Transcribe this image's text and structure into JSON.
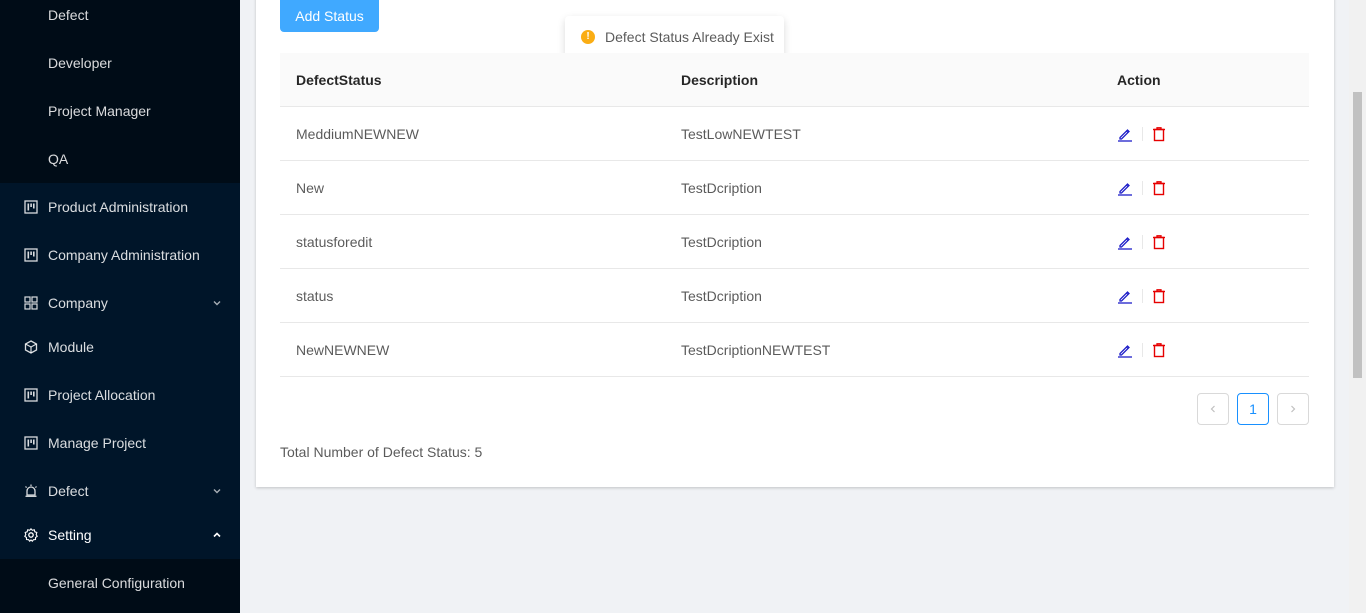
{
  "sidebar": {
    "sub_items": [
      "Defect",
      "Developer",
      "Project Manager",
      "QA"
    ],
    "items": [
      {
        "label": "Product Administration",
        "icon": "project-icon"
      },
      {
        "label": "Company Administration",
        "icon": "project-icon"
      },
      {
        "label": "Company",
        "icon": "appstore-icon",
        "arrow": "down"
      },
      {
        "label": "Module",
        "icon": "code-sandbox-icon"
      },
      {
        "label": "Project Allocation",
        "icon": "project-icon"
      },
      {
        "label": "Manage Project",
        "icon": "project-icon"
      },
      {
        "label": "Defect",
        "icon": "alert-icon",
        "arrow": "down"
      },
      {
        "label": "Setting",
        "icon": "setting-icon",
        "arrow": "up"
      }
    ],
    "setting_sub_items": [
      "General Configuration"
    ]
  },
  "toolbar": {
    "add_label": "Add Status"
  },
  "toast": {
    "message": "Defect Status Already Exist",
    "color": "#faad14"
  },
  "table": {
    "columns": [
      "DefectStatus",
      "Description",
      "Action"
    ],
    "rows": [
      {
        "status": "MeddiumNEWNEW",
        "description": "TestLowNEWTEST"
      },
      {
        "status": "New",
        "description": "TestDcription"
      },
      {
        "status": "statusforedit",
        "description": "TestDcription"
      },
      {
        "status": "status",
        "description": "TestDcription"
      },
      {
        "status": "NewNEWNEW",
        "description": "TestDcriptionNEWTEST"
      }
    ]
  },
  "pagination": {
    "prev": "<",
    "current": "1",
    "next": ">"
  },
  "footer": {
    "total_text": "Total Number of Defect Status: 5"
  },
  "colors": {
    "sidebar_bg": "#001529",
    "submenu_bg": "#000c17",
    "primary": "#40a9ff",
    "edit": "#1e1ec8",
    "delete": "#e60000"
  }
}
